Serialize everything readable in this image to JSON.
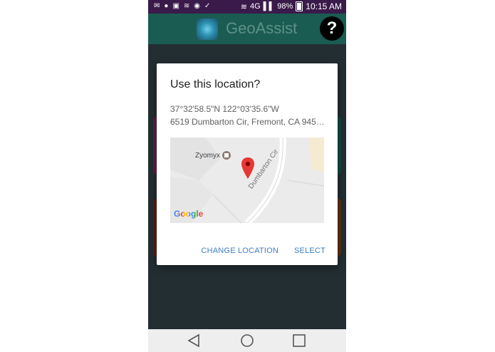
{
  "status_bar": {
    "network": "4G",
    "battery": "98%",
    "time": "10:15 AM"
  },
  "app_bar": {
    "title": "GeoAssist",
    "help_label": "?"
  },
  "dialog": {
    "title": "Use this location?",
    "coordinates": "37°32'58.5\"N 122°03'35.6\"W",
    "address": "6519 Dumbarton Cir, Fremont, CA 945…",
    "map": {
      "poi_label": "Zyomyx",
      "road_label": "Dumbarton Cir",
      "attribution": "Google"
    },
    "actions": {
      "change_location": "CHANGE LOCATION",
      "select": "SELECT"
    }
  },
  "colors": {
    "status_bar": "#3a1a4a",
    "app_bar": "#1a5c52",
    "background": "#37474f",
    "action_text": "#3f7ec4",
    "marker": "#e53935"
  }
}
